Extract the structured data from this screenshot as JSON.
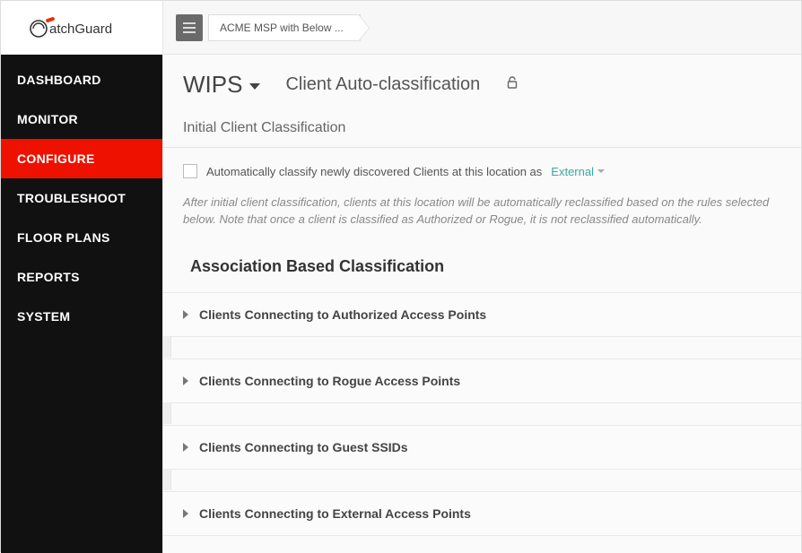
{
  "brand": "WatchGuard",
  "breadcrumb": "ACME MSP with Below ...",
  "sidebar": {
    "items": [
      {
        "label": "DASHBOARD",
        "active": false
      },
      {
        "label": "MONITOR",
        "active": false
      },
      {
        "label": "CONFIGURE",
        "active": true
      },
      {
        "label": "TROUBLESHOOT",
        "active": false
      },
      {
        "label": "FLOOR PLANS",
        "active": false
      },
      {
        "label": "REPORTS",
        "active": false
      },
      {
        "label": "SYSTEM",
        "active": false
      }
    ]
  },
  "header": {
    "dropdown_label": "WIPS",
    "page_title": "Client Auto-classification"
  },
  "section": {
    "initial_label": "Initial Client Classification",
    "auto_classify_label": "Automatically classify newly discovered Clients at this location as",
    "auto_classify_value": "External",
    "helptext": "After initial client classification, clients at this location will be automatically reclassified based on the rules selected below. Note that once a client is classified as Authorized or Rogue, it is not reclassified automatically."
  },
  "association": {
    "heading": "Association Based Classification",
    "items": [
      {
        "title": "Clients Connecting to Authorized Access Points"
      },
      {
        "title": "Clients Connecting to Rogue Access Points"
      },
      {
        "title": "Clients Connecting to Guest SSIDs"
      },
      {
        "title": "Clients Connecting to External Access Points"
      }
    ]
  }
}
